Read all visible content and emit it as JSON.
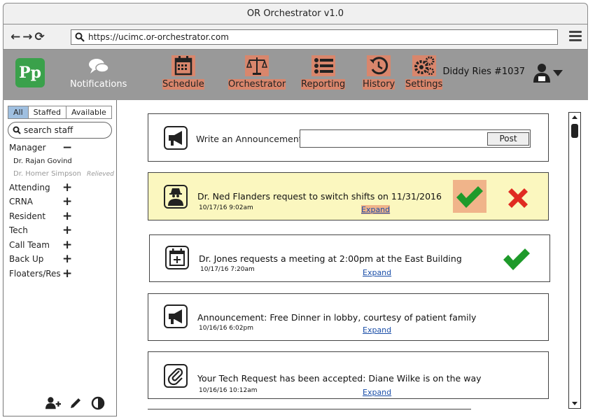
{
  "window": {
    "title": "OR Orchestrator v1.0"
  },
  "browser": {
    "url": "https://ucimc.or-orchestrator.com"
  },
  "header": {
    "logo_text": "Pp",
    "notifications_label": "Notifications",
    "nav": [
      {
        "label": "Schedule",
        "icon": "calendar-icon"
      },
      {
        "label": "Orchestrator",
        "icon": "scales-icon"
      },
      {
        "label": "Reporting",
        "icon": "list-icon"
      },
      {
        "label": "History",
        "icon": "history-icon"
      },
      {
        "label": "Settings",
        "icon": "gears-icon"
      }
    ],
    "user_name": "Diddy Ries #1037",
    "highlight_color": "#d9866c"
  },
  "sidebar": {
    "tabs": [
      "All",
      "Staffed",
      "Available"
    ],
    "search_placeholder": "search staff",
    "groups": [
      {
        "label": "Manager",
        "symbol": "−"
      },
      {
        "label": "Attending",
        "symbol": "+"
      },
      {
        "label": "CRNA",
        "symbol": "+"
      },
      {
        "label": "Resident",
        "symbol": "+"
      },
      {
        "label": "Tech",
        "symbol": "+"
      },
      {
        "label": "Call Team",
        "symbol": "+"
      },
      {
        "label": "Back Up",
        "symbol": "+"
      },
      {
        "label": "Floaters/Res",
        "symbol": "+"
      }
    ],
    "manager_members": [
      {
        "name": "Dr. Rajan Govind",
        "status": ""
      },
      {
        "name": "Dr. Homer Simpson",
        "status": "Relieved"
      }
    ]
  },
  "main": {
    "announcement": {
      "label": "Write an Announcement:",
      "input_value": "",
      "post_label": "Post"
    },
    "notifications": [
      {
        "text": "Dr. Ned Flanders request to switch shifts on 11/31/2016",
        "time": "10/17/16  9:02am",
        "expand": "Expand",
        "icon": "spy-icon",
        "actions": [
          "approve",
          "reject"
        ]
      },
      {
        "text": "Dr. Jones requests a meeting at 2:00pm at the East Building",
        "time": "10/17/16  7:20am",
        "expand": "Expand",
        "icon": "calendar-plus-icon",
        "actions": [
          "approve"
        ]
      },
      {
        "text": "Announcement: Free Dinner in lobby, courtesy of patient family",
        "time": "10/16/16  6:02pm",
        "expand": "Expand",
        "icon": "megaphone-icon",
        "actions": []
      },
      {
        "text": "Your Tech Request has been accepted: Diane Wilke is on the way",
        "time": "10/16/16  10:12am",
        "expand": "Expand",
        "icon": "paperclip-icon",
        "actions": []
      }
    ]
  },
  "colors": {
    "approve": "#1e9a2a",
    "reject": "#e02b22",
    "highlight_card": "#fbf7bf",
    "header_bg": "#999999",
    "logo": "#3aa14b"
  }
}
